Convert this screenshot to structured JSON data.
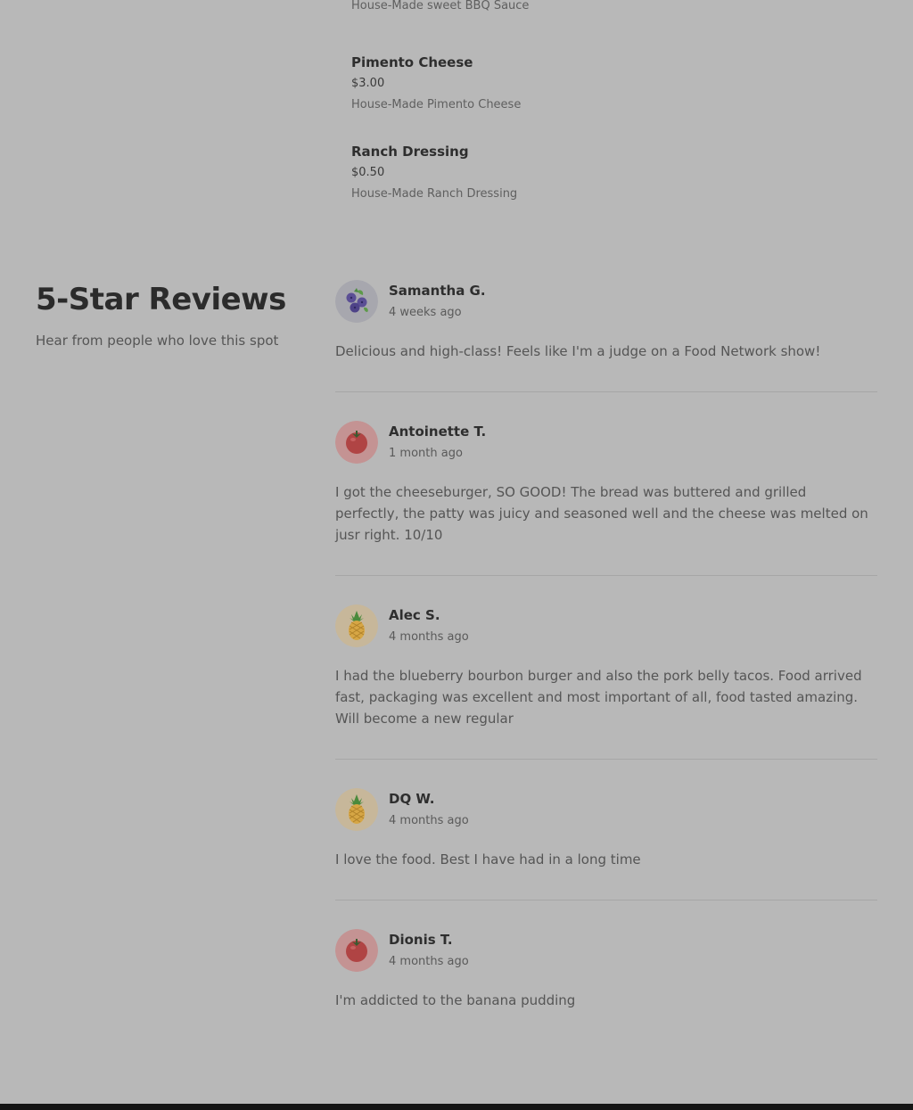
{
  "menu": {
    "items": [
      {
        "name": "",
        "price": "",
        "description": "House-Made sweet BBQ Sauce"
      },
      {
        "name": "Pimento Cheese",
        "price": "$3.00",
        "description": "House-Made Pimento Cheese"
      },
      {
        "name": "Ranch Dressing",
        "price": "$0.50",
        "description": "House-Made Ranch Dressing"
      }
    ]
  },
  "reviews": {
    "title": "5-Star Reviews",
    "subtitle": "Hear from people who love this spot",
    "items": [
      {
        "name": "Samantha G.",
        "date": "4 weeks ago",
        "text": "Delicious and high-class! Feels like I'm a judge on a Food Network show!",
        "avatar_icon": "blueberry-icon"
      },
      {
        "name": "Antoinette T.",
        "date": "1 month ago",
        "text": "I got the cheeseburger, SO GOOD! The bread was buttered and grilled perfectly, the patty was juicy and seasoned well and the cheese was melted on jusr right. 10/10",
        "avatar_icon": "tomato-icon"
      },
      {
        "name": "Alec S.",
        "date": "4 months ago",
        "text": "I had the blueberry bourbon burger and also the pork belly tacos. Food arrived fast, packaging was excellent and most important of all, food tasted amazing. Will become a new regular",
        "avatar_icon": "pineapple-icon"
      },
      {
        "name": "DQ W.",
        "date": "4 months ago",
        "text": "I love the food. Best I have had in a long time",
        "avatar_icon": "pineapple-icon"
      },
      {
        "name": "Dionis T.",
        "date": "4 months ago",
        "text": "I'm addicted to the banana pudding",
        "avatar_icon": "tomato-icon"
      }
    ]
  },
  "colors": {
    "overlay_background": "#b8b8b8",
    "footer": "#151515"
  }
}
